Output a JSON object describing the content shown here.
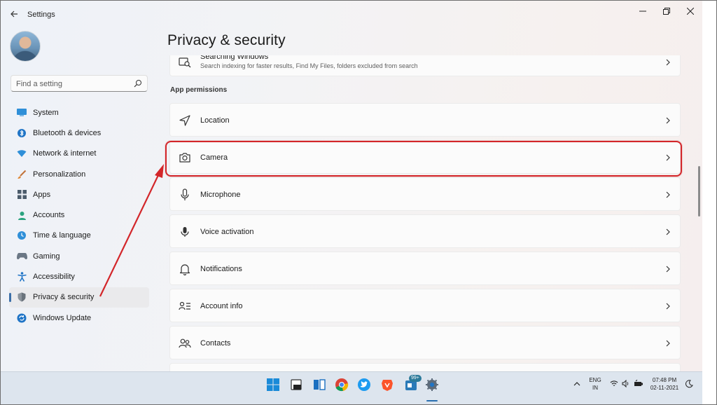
{
  "window": {
    "app_title": "Settings",
    "page_title": "Privacy & security"
  },
  "sidebar": {
    "search_placeholder": "Find a setting",
    "items": [
      {
        "label": "System",
        "icon": "system-icon"
      },
      {
        "label": "Bluetooth & devices",
        "icon": "bluetooth-icon"
      },
      {
        "label": "Network & internet",
        "icon": "wifi-icon"
      },
      {
        "label": "Personalization",
        "icon": "brush-icon"
      },
      {
        "label": "Apps",
        "icon": "apps-icon"
      },
      {
        "label": "Accounts",
        "icon": "account-icon"
      },
      {
        "label": "Time & language",
        "icon": "globe-clock-icon"
      },
      {
        "label": "Gaming",
        "icon": "gamepad-icon"
      },
      {
        "label": "Accessibility",
        "icon": "accessibility-icon"
      },
      {
        "label": "Privacy & security",
        "icon": "shield-icon",
        "selected": true
      },
      {
        "label": "Windows Update",
        "icon": "update-icon"
      }
    ]
  },
  "main": {
    "partial_card": {
      "title": "Searching Windows",
      "subtitle": "Search indexing for faster results, Find My Files, folders excluded from search"
    },
    "section_label": "App permissions",
    "permissions": [
      {
        "label": "Location",
        "icon": "location-icon"
      },
      {
        "label": "Camera",
        "icon": "camera-icon",
        "highlighted": true
      },
      {
        "label": "Microphone",
        "icon": "microphone-icon"
      },
      {
        "label": "Voice activation",
        "icon": "voice-activation-icon"
      },
      {
        "label": "Notifications",
        "icon": "bell-icon"
      },
      {
        "label": "Account info",
        "icon": "account-info-icon"
      },
      {
        "label": "Contacts",
        "icon": "contacts-icon"
      }
    ]
  },
  "taskbar": {
    "apps": [
      "start-icon",
      "search-icon",
      "task-view-icon",
      "chrome-icon",
      "twitter-icon",
      "brave-icon",
      "news-icon",
      "settings-icon"
    ],
    "badge": "99+",
    "language_line1": "ENG",
    "language_line2": "IN",
    "time": "07:48 PM",
    "date": "02-11-2021"
  },
  "colors": {
    "accent": "#3b6ea8",
    "annotation_red": "#d3262a",
    "taskbar_bg": "#dde5ee"
  }
}
